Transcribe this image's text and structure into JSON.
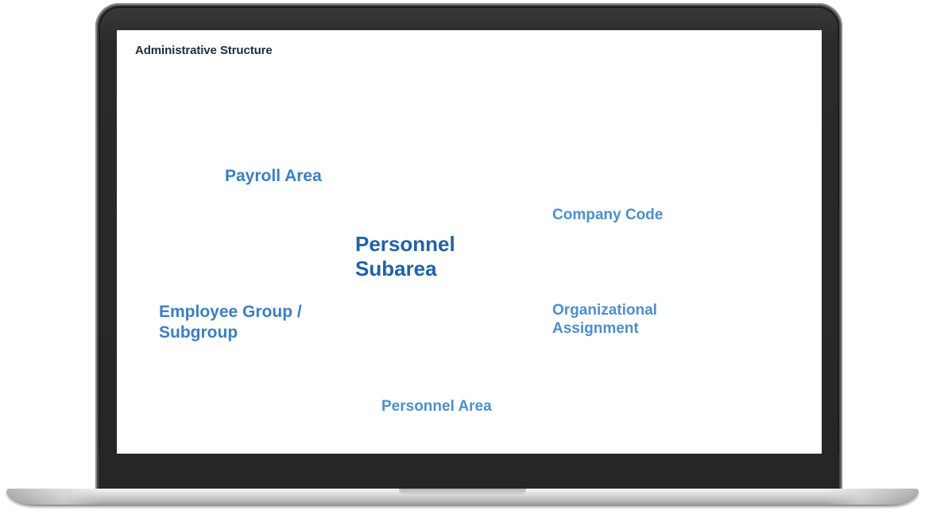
{
  "slide": {
    "title": "Administrative Structure",
    "terms": {
      "payroll_area": "Payroll Area",
      "company_code": "Company Code",
      "personnel_subarea_line1": "Personnel",
      "personnel_subarea_line2": "Subarea",
      "employee_group_line1": "Employee Group /",
      "employee_group_line2": "Subgroup",
      "organizational_line1": "Organizational",
      "organizational_line2": "Assignment",
      "personnel_area": "Personnel Area"
    }
  },
  "colors": {
    "title": "#1d2d3e",
    "term_primary": "#1f63a8",
    "term_secondary": "#3a7fc4",
    "term_light": "#4a8fd3",
    "bezel": "#262626"
  }
}
